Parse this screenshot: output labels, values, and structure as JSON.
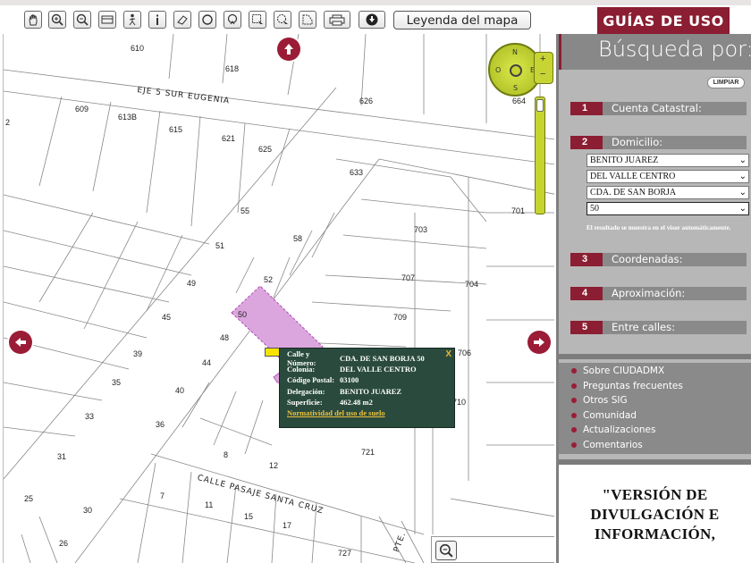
{
  "toolbar": {
    "legend_label": "Leyenda del mapa",
    "guides_label": "GUÍAS DE USO"
  },
  "map": {
    "lots": [
      {
        "id": "610",
        "label": "610"
      },
      {
        "id": "618",
        "label": "618"
      },
      {
        "id": "626",
        "label": "626"
      },
      {
        "id": "664",
        "label": "664"
      },
      {
        "id": "609",
        "label": "609"
      },
      {
        "id": "613B",
        "label": "613B"
      },
      {
        "id": "615",
        "label": "615"
      },
      {
        "id": "621",
        "label": "621"
      },
      {
        "id": "625",
        "label": "625"
      },
      {
        "id": "2",
        "label": "2"
      },
      {
        "id": "633",
        "label": "633"
      },
      {
        "id": "701",
        "label": "701"
      },
      {
        "id": "55",
        "label": "55"
      },
      {
        "id": "58",
        "label": "58"
      },
      {
        "id": "703",
        "label": "703"
      },
      {
        "id": "51",
        "label": "51"
      },
      {
        "id": "49",
        "label": "49"
      },
      {
        "id": "52",
        "label": "52"
      },
      {
        "id": "707",
        "label": "707"
      },
      {
        "id": "704",
        "label": "704"
      },
      {
        "id": "50",
        "label": "50"
      },
      {
        "id": "45",
        "label": "45"
      },
      {
        "id": "709",
        "label": "709"
      },
      {
        "id": "48",
        "label": "48"
      },
      {
        "id": "39",
        "label": "39"
      },
      {
        "id": "44",
        "label": "44"
      },
      {
        "id": "706",
        "label": "706"
      },
      {
        "id": "35",
        "label": "35"
      },
      {
        "id": "40",
        "label": "40"
      },
      {
        "id": "710",
        "label": "710"
      },
      {
        "id": "33",
        "label": "33"
      },
      {
        "id": "36",
        "label": "36"
      },
      {
        "id": "31",
        "label": "31"
      },
      {
        "id": "8",
        "label": "8"
      },
      {
        "id": "12",
        "label": "12"
      },
      {
        "id": "721",
        "label": "721"
      },
      {
        "id": "25",
        "label": "25"
      },
      {
        "id": "7",
        "label": "7"
      },
      {
        "id": "11",
        "label": "11"
      },
      {
        "id": "15",
        "label": "15"
      },
      {
        "id": "17",
        "label": "17"
      },
      {
        "id": "30",
        "label": "30"
      },
      {
        "id": "26",
        "label": "26"
      },
      {
        "id": "727",
        "label": "727"
      }
    ],
    "streets": {
      "eje5": "EJE 5 SUR EUGENIA",
      "pasaje": "CALLE PASAJE SANTA CRUZ",
      "pte": "PTE."
    },
    "compass": {
      "n": "N",
      "s": "S",
      "e": "E",
      "o": "O",
      "zoom_in": "+",
      "zoom_out": "−"
    }
  },
  "popup": {
    "close": "X",
    "rows": [
      {
        "k": "Calle y Número:",
        "v": "CDA. DE SAN BORJA 50"
      },
      {
        "k": "Colonia:",
        "v": "DEL VALLE CENTRO"
      },
      {
        "k": "Código Postal:",
        "v": "03100"
      },
      {
        "k": "Delegación:",
        "v": "BENITO JUAREZ"
      },
      {
        "k": "Superficie:",
        "v": "462.48 m2"
      }
    ],
    "link": "Normatividad del uso de suelo"
  },
  "panel": {
    "title": "Búsqueda por:",
    "limpiar": "LIMPIAR",
    "sections": [
      {
        "num": "1",
        "label": "Cuenta Catastral:"
      },
      {
        "num": "2",
        "label": "Domicilio:"
      },
      {
        "num": "3",
        "label": "Coordenadas:"
      },
      {
        "num": "4",
        "label": "Aproximación:"
      },
      {
        "num": "5",
        "label": "Entre calles:"
      }
    ],
    "selects": [
      "BENITO JUAREZ",
      "DEL VALLE CENTRO",
      "CDA. DE SAN BORJA",
      "50"
    ],
    "note": "El resultado se muestra en el visor automáticamente.",
    "links": [
      "Sobre CIUDADMX",
      "Preguntas frecuentes",
      "Otros SIG",
      "Comunidad",
      "Actualizaciones",
      "Comentarios"
    ],
    "version": [
      "\"VERSIÓN DE",
      "DIVULGACIÓN E",
      "INFORMACIÓN,"
    ]
  },
  "colors": {
    "brand": "#8b1e32",
    "panel": "#b7b7b7",
    "popup": "#2a4a3e",
    "highlight": "#dba6dd"
  }
}
